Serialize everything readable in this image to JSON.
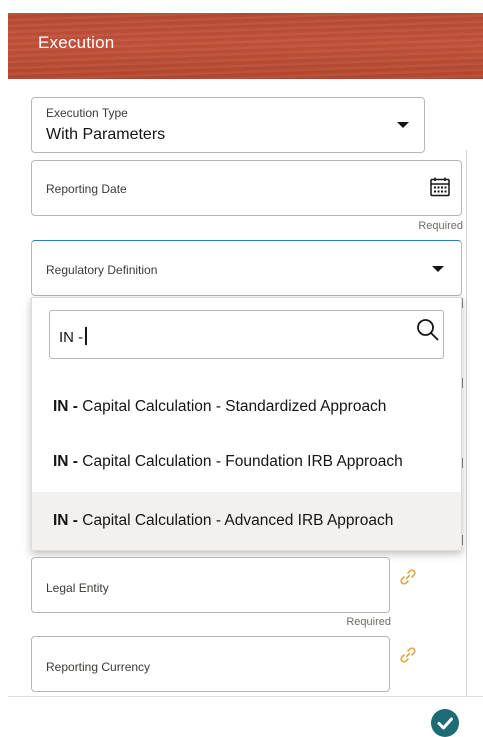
{
  "header": {
    "title": "Execution"
  },
  "fields": {
    "execution_type": {
      "label": "Execution Type",
      "value": "With Parameters"
    },
    "reporting_date": {
      "label": "Reporting Date",
      "required": "Required"
    },
    "regulatory_definition": {
      "label": "Regulatory Definition"
    },
    "legal_entity": {
      "label": "Legal Entity",
      "required": "Required"
    },
    "reporting_currency": {
      "label": "Reporting Currency"
    }
  },
  "dropdown": {
    "search_value": "IN -",
    "options": [
      {
        "prefix": "IN -",
        "text": " Capital Calculation - Standardized Approach"
      },
      {
        "prefix": "IN -",
        "text": " Capital Calculation - Foundation IRB Approach"
      },
      {
        "prefix": "IN -",
        "text": " Capital Calculation - Advanced IRB Approach",
        "highlighted": true
      }
    ]
  },
  "colors": {
    "header": "#b84a33",
    "accent": "#1d6b74",
    "link_icon": "#e0a64a"
  }
}
